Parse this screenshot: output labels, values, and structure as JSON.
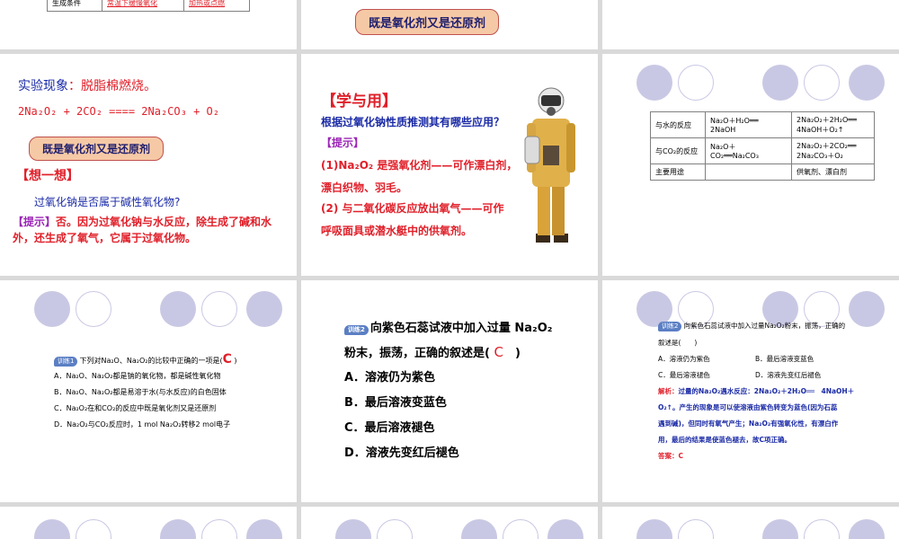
{
  "slide1": {
    "row_label": "生成条件",
    "cell_a": "常温下缓慢氧化",
    "cell_b": "加热或点燃"
  },
  "slide2": {
    "callout": "既是氧化剂又是还原剂"
  },
  "slide4": {
    "phenomenon_label": "实验现象",
    "phenomenon_text": "：脱脂棉燃烧。",
    "equation": "2Na₂O₂ + 2CO₂ ==== 2Na₂CO₃ + O₂",
    "callout": "既是氧化剂又是还原剂",
    "think_title": "【想一想】",
    "question": "过氧化钠是否属于碱性氧化物?",
    "hint_label": "【提示】",
    "hint_text": "否。因为过氧化钠与水反应，除生成了碱和水外，还生成了氧气，它属于过氧化物。"
  },
  "slide5": {
    "title": "【学与用】",
    "question": "根据过氧化钠性质推测其有哪些应用？",
    "hint_label": "【提示】",
    "point1": "(1)Na₂O₂ 是强氧化剂——可作漂白剂，",
    "point1b": "漂白织物、羽毛。",
    "point2": "(2) 与二氧化碳反应放出氧气——可作",
    "point2b": "呼吸面具或潜水艇中的供氧剂。"
  },
  "slide6": {
    "rows": [
      {
        "label": "与水的反应",
        "a": "Na₂O＋H₂O══\n2NaOH",
        "b": "2Na₂O₂＋2H₂O══\n4NaOH＋O₂↑"
      },
      {
        "label": "与CO₂的反应",
        "a": "Na₂O＋\nCO₂══Na₂CO₃",
        "b": "2Na₂O₂＋2CO₂══\n2Na₂CO₃＋O₂"
      },
      {
        "label": "主要用途",
        "a": "",
        "b": "供氧剂、漂白剂"
      }
    ]
  },
  "slide7": {
    "badge": "训练",
    "badge_num": "1",
    "stem": "下列对Na₂O、Na₂O₂的比较中正确的一项是(",
    "answer": "C",
    "stem_end": ")",
    "options": [
      "A．Na₂O、Na₂O₂都是钠的氧化物，都是碱性氧化物",
      "B．Na₂O、Na₂O₂都是易溶于水(与水反应)的白色固体",
      "C．Na₂O₂在和CO₂的反应中既是氧化剂又是还原剂",
      "D．Na₂O₂与CO₂反应时，1 mol Na₂O₂转移2 mol电子"
    ]
  },
  "slide8": {
    "badge": "训练",
    "badge_num": "2",
    "stem1": "向紫色石蕊试液中加入过量 Na₂O₂",
    "stem2": "粉末，振荡，正确的叙述是(",
    "answer": "C",
    "stem_end": ")",
    "options": [
      "A．溶液仍为紫色",
      "B．最后溶液变蓝色",
      "C．最后溶液褪色",
      "D．溶液先变红后褪色"
    ]
  },
  "slide9": {
    "badge": "训练",
    "badge_num": "2",
    "stem1": "向紫色石蕊试液中加入过量Na₂O₂粉末，振荡，正确的",
    "stem2": "叙述是(　　)",
    "opt_a": "A．溶液仍为紫色",
    "opt_b": "B．最后溶液变蓝色",
    "opt_c": "C．最后溶液褪色",
    "opt_d": "D．溶液先变红后褪色",
    "analysis_label": "解析：",
    "analysis_lines": [
      "过量的Na₂O₂遇水反应：2Na₂O₂＋2H₂O══　4NaOH＋",
      "O₂↑。产生的现象是可以使溶液由紫色转变为蓝色(因为石蕊",
      "遇到碱)，但同时有氧气产生；Na₂O₂有强氧化性，有漂白作",
      "用，最后的结果是使蓝色褪去，故C项正确。"
    ],
    "answer_line": "答案：C"
  },
  "colors": {
    "red": "#e0202a",
    "blue": "#1a2aa6",
    "purple": "#9b26b6",
    "callout_bg": "#f6c9a6",
    "circle": "#c9c8e4"
  }
}
